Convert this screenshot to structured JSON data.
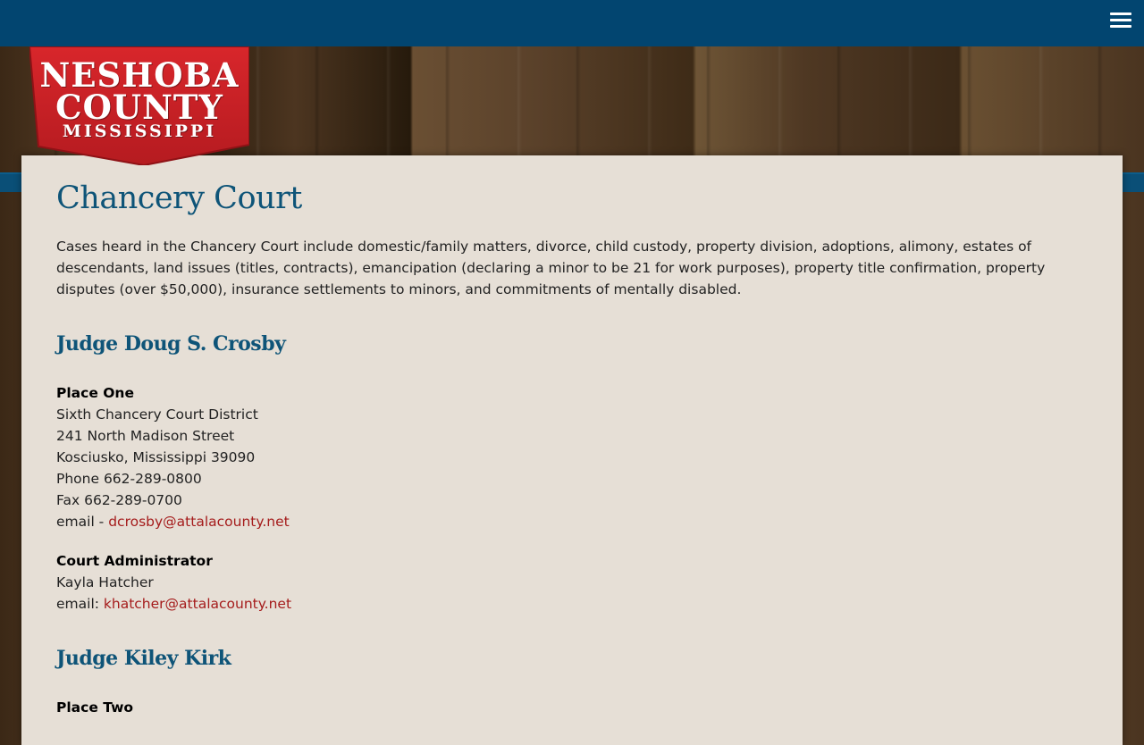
{
  "logo": {
    "line1": "NESHOBA",
    "line2": "COUNTY",
    "line3": "MISSISSIPPI"
  },
  "header": {
    "menu_icon": "hamburger-menu-icon"
  },
  "page": {
    "title": "Chancery Court",
    "intro": "Cases heard in the Chancery Court include domestic/family matters, divorce, child custody, property division, adoptions, alimony, estates of descendants, land issues (titles, contracts), emancipation (declaring a minor to be 21 for work purposes), property title confirmation, property disputes (over $50,000), insurance settlements to minors, and commitments of mentally disabled."
  },
  "judge1": {
    "name": "Judge Doug S. Crosby",
    "place": "Place One",
    "district": "Sixth Chancery Court District",
    "street": "241 North Madison Street",
    "city": "Kosciusko, Mississippi 39090",
    "phone": "Phone 662-289-0800",
    "fax": "Fax 662-289-0700",
    "email_label": "email - ",
    "email": "dcrosby@attalacounty.net",
    "admin_heading": "Court Administrator",
    "admin_name": "Kayla Hatcher",
    "admin_email_label": "email: ",
    "admin_email": "khatcher@attalacounty.net"
  },
  "judge2": {
    "name": "Judge Kiley Kirk",
    "place": "Place Two"
  },
  "colors": {
    "topbar": "#024570",
    "heading": "#0e5478",
    "link": "#a51c1c",
    "panel": "#e6dfd6",
    "logo_red": "#cc2227"
  }
}
